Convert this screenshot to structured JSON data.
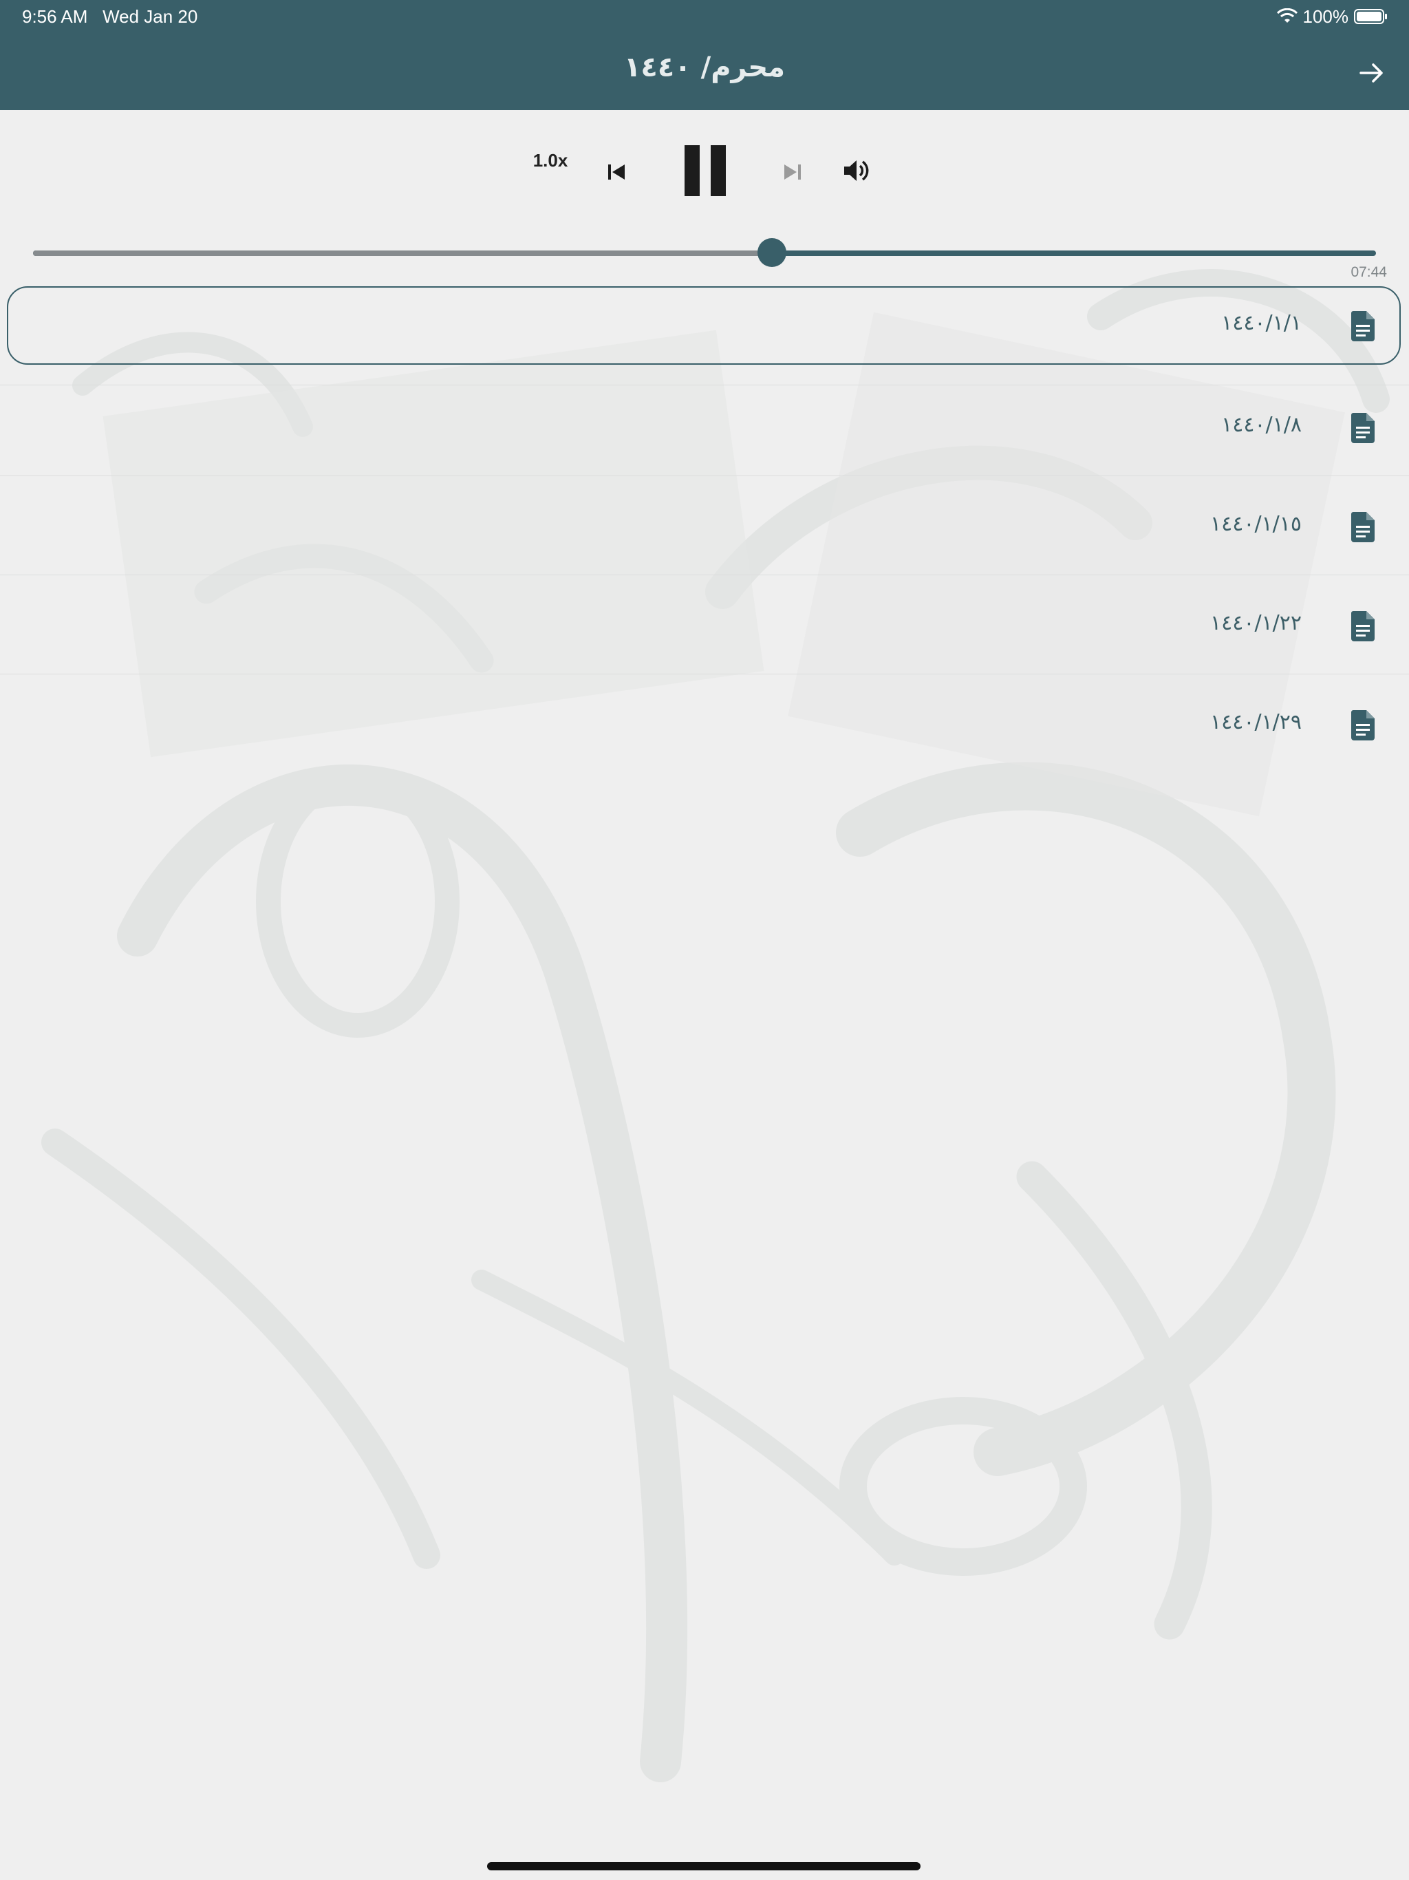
{
  "status_bar": {
    "time": "9:56 AM",
    "date": "Wed Jan 20",
    "battery": "100%"
  },
  "header": {
    "title": "محرم/ ١٤٤٠",
    "back_icon": "arrow-right-icon",
    "background_color": "#395f69"
  },
  "player": {
    "speed": "1.0x",
    "progress_fraction": 0.55,
    "duration": "07:44",
    "controls": [
      "skip-previous-icon",
      "pause-icon",
      "skip-next-icon",
      "volume-icon"
    ],
    "accent_color": "#395f69"
  },
  "episodes": [
    {
      "label": "١٤٤٠/١/١",
      "selected": true,
      "icon": "document-icon"
    },
    {
      "label": "١٤٤٠/١/٨",
      "selected": false,
      "icon": "document-icon"
    },
    {
      "label": "١٤٤٠/١/١٥",
      "selected": false,
      "icon": "document-icon"
    },
    {
      "label": "١٤٤٠/١/٢٢",
      "selected": false,
      "icon": "document-icon"
    },
    {
      "label": "١٤٤٠/١/٢٩",
      "selected": false,
      "icon": "document-icon"
    }
  ]
}
